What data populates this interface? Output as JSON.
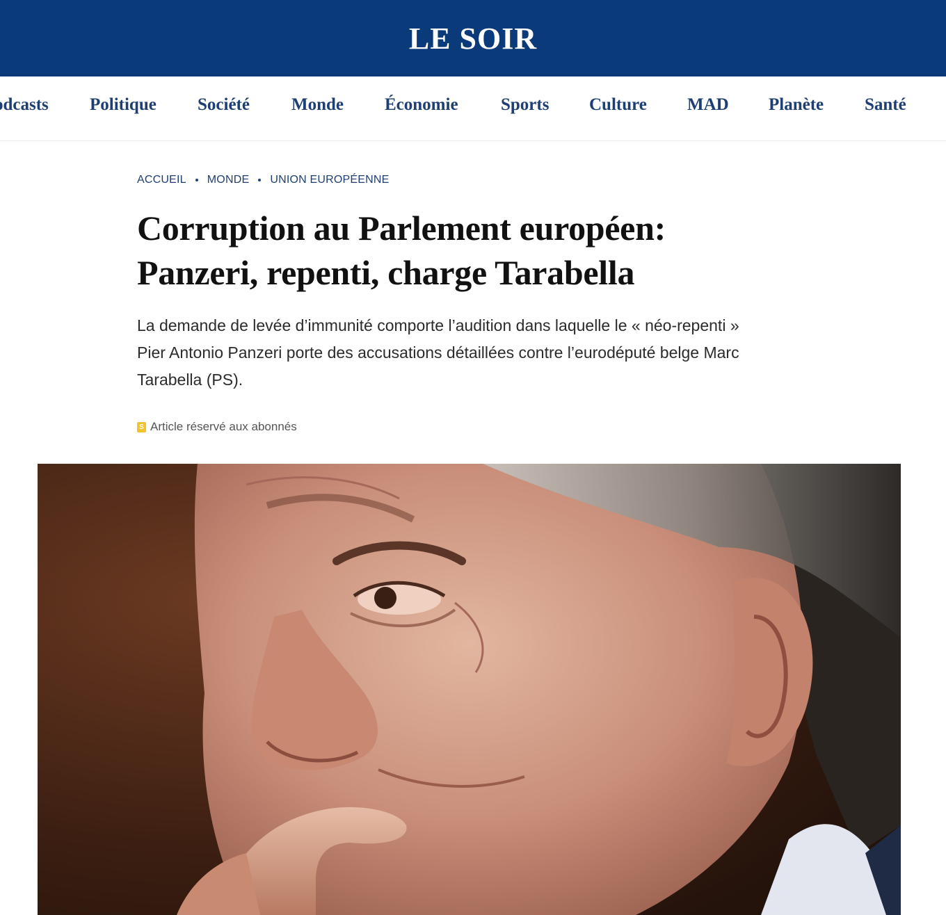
{
  "header": {
    "logo": "LE SOIR",
    "bar_color": "#0b3a7a"
  },
  "nav": {
    "items": [
      "odcasts",
      "Politique",
      "Société",
      "Monde",
      "Économie",
      "Sports",
      "Culture",
      "MAD",
      "Planète",
      "Santé"
    ]
  },
  "breadcrumb": {
    "items": [
      "ACCUEIL",
      "MONDE",
      "UNION EUROPÉENNE"
    ]
  },
  "article": {
    "headline_line1": "Corruption au Parlement européen:",
    "headline_line2": "Panzeri, repenti, charge Tarabella",
    "lede": "La demande de levée d’immunité comporte l’audition dans laquelle le « néo-repenti » Pier Antonio Panzeri porte des accusations détaillées contre l’eurodéputé belge Marc Tarabella (PS).",
    "premium_label": "Article réservé aux abonnés",
    "premium_icon": "subscriber-badge-icon",
    "premium_color": "#f2c233"
  },
  "photo": {
    "icon": "portrait-photo"
  }
}
